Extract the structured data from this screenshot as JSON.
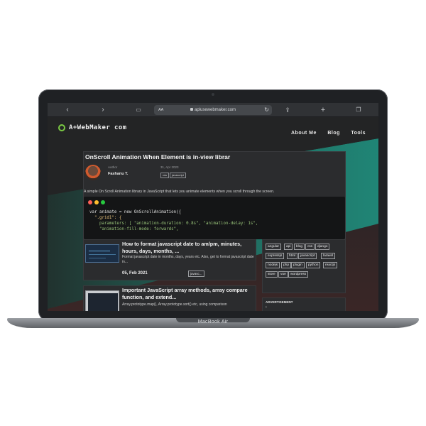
{
  "device": {
    "label": "MacBook Air"
  },
  "browser": {
    "address_prefix": "AA",
    "url": "aplusewebmaker.com",
    "back_icon": "chevron-left-icon",
    "forward_icon": "chevron-right-icon",
    "reader_icon": "book-icon",
    "reload_icon": "reload-icon",
    "share_icon": "share-icon",
    "new_tab_icon": "plus-icon",
    "tabs_icon": "tabs-icon"
  },
  "site": {
    "logo": "A+WebMaker com",
    "nav": [
      "About Me",
      "Blog",
      "Tools"
    ],
    "colors": {
      "accent_teal": "#1f8a7a",
      "background": "#232425",
      "card": "#2b2c2e"
    },
    "hero": {
      "title": "OnScroll Animation When Element is in-view librar",
      "author_label": "Author",
      "author_name": "Fashanu T.",
      "date": "31, Apr 2023",
      "tags": [
        "css",
        "javascript"
      ],
      "description": "A simple On Scroll Animation library in JavaScript that lets you animate elements when you scroll through the screen.",
      "code": [
        "var animate = new OnScrollAnimation({",
        "  \".grid1\": {",
        "    parameters: [ \"animation-duration: 0.8s\", \"animation-delay: 1s\",",
        "    \"animation-fill-mode: forwards\","
      ]
    },
    "posts": [
      {
        "title": "How to format javascript date to am/pm, minutes, hours, days, months, ...",
        "excerpt": "Format javascript date in months, days, years etc. Also, get to format javascript date in...",
        "date": "05, Feb 2021",
        "tag": "javasc..."
      },
      {
        "title": "Important JavaScript array methods, array compare function, and extend...",
        "excerpt": "Array.prototype.map(), Array.prototype.sort() etc, using comparison"
      }
    ],
    "tags": [
      "angular",
      "api",
      "blog",
      "css",
      "django",
      "expressjs",
      "html",
      "javascript",
      "laravel",
      "nodejs",
      "php",
      "plugin",
      "python",
      "reactjs",
      "store",
      "vue",
      "wordpress"
    ],
    "ad_title": "ADVERTISEMENT"
  }
}
